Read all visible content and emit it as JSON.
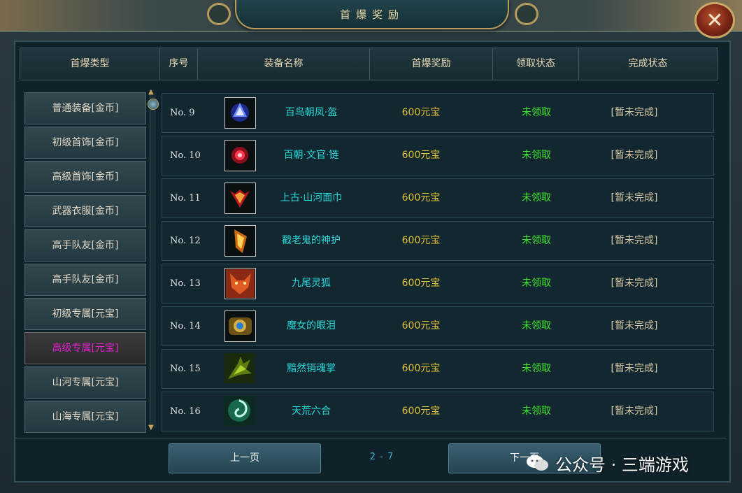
{
  "window": {
    "title": "首爆奖励",
    "close_icon": "close-x-icon"
  },
  "table": {
    "headers": [
      "首爆类型",
      "序号",
      "装备名称",
      "首爆奖励",
      "领取状态",
      "完成状态"
    ]
  },
  "sidebar": {
    "items": [
      {
        "label": "普通装备[金币]"
      },
      {
        "label": "初级首饰[金币]"
      },
      {
        "label": "高级首饰[金币]"
      },
      {
        "label": "武器衣服[金币]"
      },
      {
        "label": "高手队友[金币]"
      },
      {
        "label": "高手队友[金币]"
      },
      {
        "label": "初级专属[元宝]"
      },
      {
        "label": "高级专属[元宝]",
        "active": true
      },
      {
        "label": "山河专属[元宝]"
      },
      {
        "label": "山海专属[元宝]"
      }
    ]
  },
  "rows": [
    {
      "no": "No. 9",
      "name": "百鸟朝凤·盔",
      "reward": "600元宝",
      "claim": "未领取",
      "done": "[暂未完成]",
      "icon": "helmet-icon"
    },
    {
      "no": "No. 10",
      "name": "百朝·文官·链",
      "reward": "600元宝",
      "claim": "未领取",
      "done": "[暂未完成]",
      "icon": "necklace-icon"
    },
    {
      "no": "No. 11",
      "name": "上古·山河面巾",
      "reward": "600元宝",
      "claim": "未领取",
      "done": "[暂未完成]",
      "icon": "mask-icon"
    },
    {
      "no": "No. 12",
      "name": "戳老鬼的神护",
      "reward": "600元宝",
      "claim": "未领取",
      "done": "[暂未完成]",
      "icon": "amulet-icon"
    },
    {
      "no": "No. 13",
      "name": "九尾灵狐",
      "reward": "600元宝",
      "claim": "未领取",
      "done": "[暂未完成]",
      "icon": "fox-icon"
    },
    {
      "no": "No. 14",
      "name": "魔女的眼泪",
      "reward": "600元宝",
      "claim": "未领取",
      "done": "[暂未完成]",
      "icon": "gem-icon"
    },
    {
      "no": "No. 15",
      "name": "黯然销魂掌",
      "reward": "600元宝",
      "claim": "未领取",
      "done": "[暂未完成]",
      "icon": "claw-icon"
    },
    {
      "no": "No. 16",
      "name": "天荒六合",
      "reward": "600元宝",
      "claim": "未领取",
      "done": "[暂未完成]",
      "icon": "swirl-icon"
    }
  ],
  "pagination": {
    "prev_label": "上一页",
    "next_label": "下一页",
    "page_text": "2 - 7"
  },
  "watermark": {
    "text": "公众号 · 三端游戏"
  },
  "colors": {
    "item_name": "#27d9d9",
    "reward": "#e1c233",
    "claim_status": "#3fe62c",
    "done_status": "#d9c8a6",
    "active_category": "#e61fd0"
  }
}
